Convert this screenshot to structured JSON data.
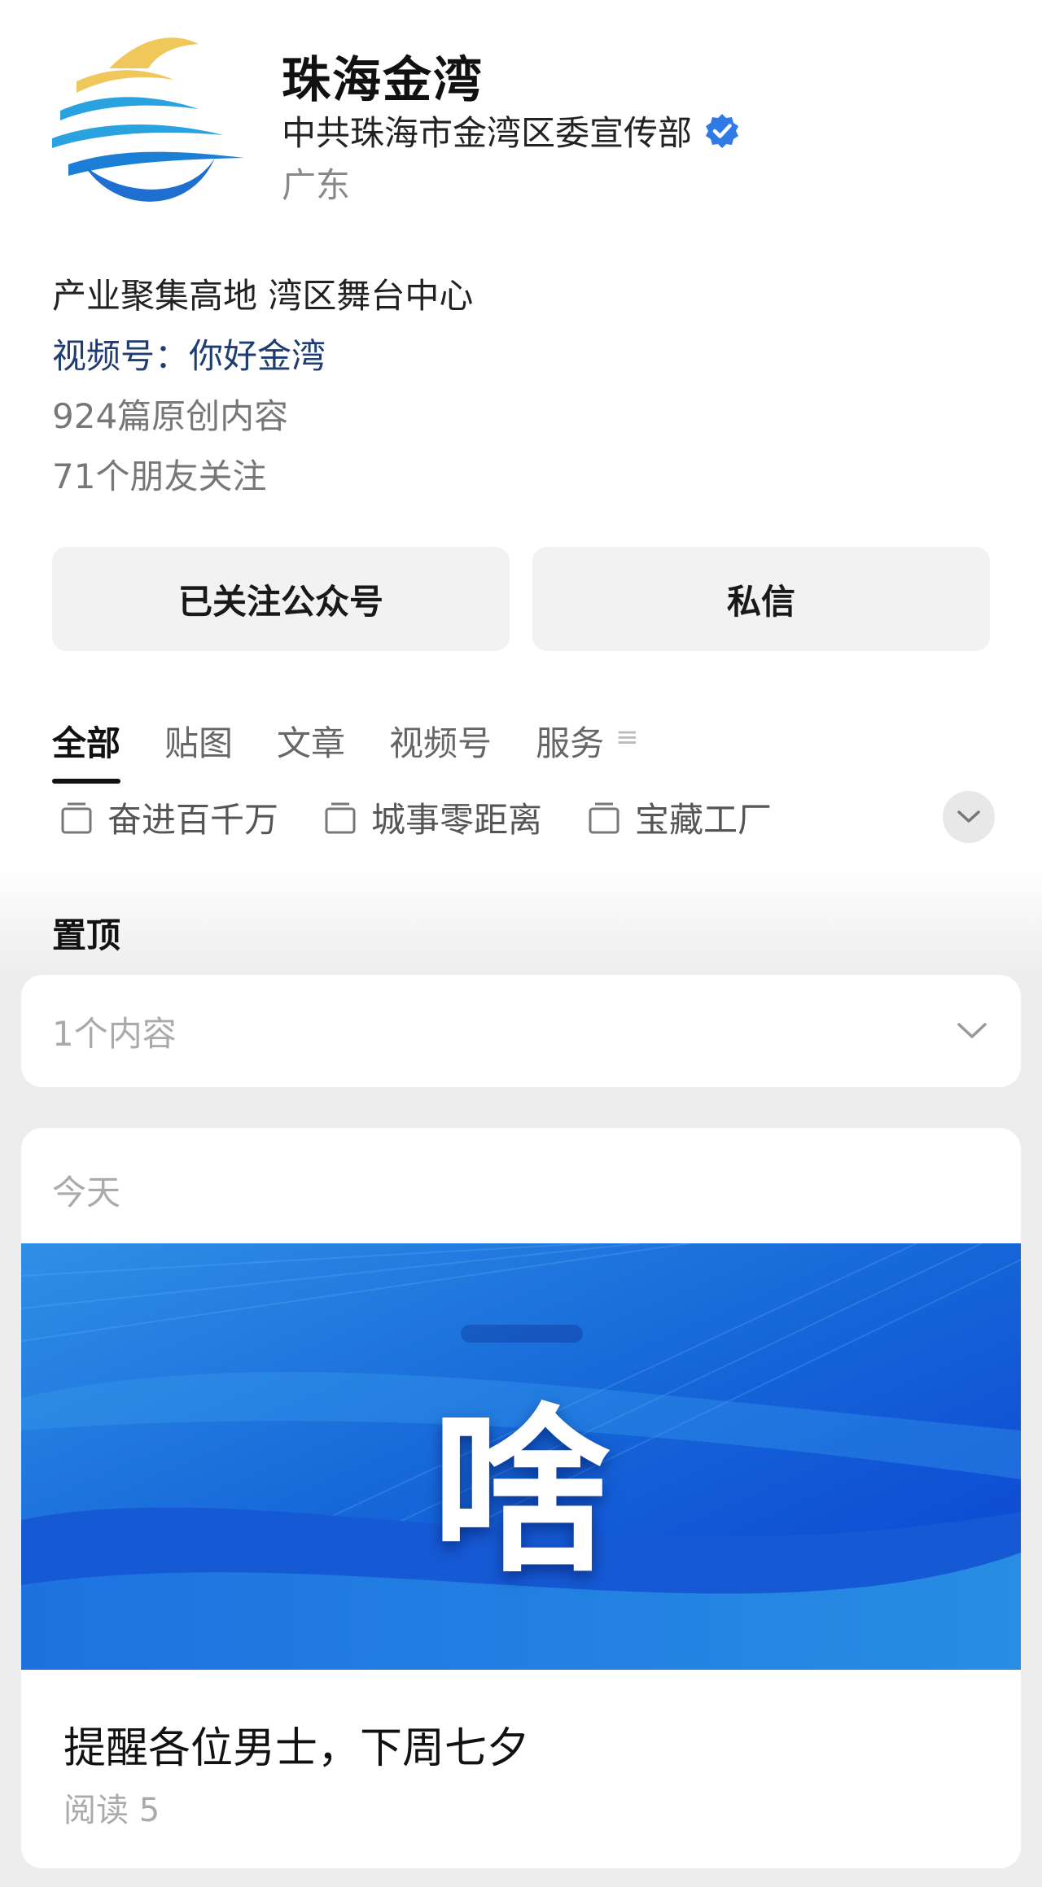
{
  "profile": {
    "name": "珠海金湾",
    "organization": "中共珠海市金湾区委宣传部",
    "region": "广东",
    "bio": "产业聚集高地 湾区舞台中心",
    "channel": "视频号：你好金湾",
    "original_count": "924篇原创内容",
    "friends_following": "71个朋友关注"
  },
  "actions": {
    "follow_label": "已关注公众号",
    "message_label": "私信"
  },
  "tabs": [
    {
      "label": "全部",
      "active": true
    },
    {
      "label": "贴图",
      "active": false
    },
    {
      "label": "文章",
      "active": false
    },
    {
      "label": "视频号",
      "active": false
    },
    {
      "label": "服务",
      "active": false
    }
  ],
  "albums": [
    {
      "label": "奋进百千万",
      "icon": "album-icon"
    },
    {
      "label": "城事零距离",
      "icon": "album-icon"
    },
    {
      "label": "宝藏工厂",
      "icon": "album-icon"
    }
  ],
  "pinned": {
    "title": "置顶",
    "summary": "1个内容"
  },
  "feed": {
    "date": "今天",
    "cover_text": "啥",
    "article_title": "提醒各位男士，下周七夕",
    "reads": "阅读 5"
  },
  "colors": {
    "channel_link": "#1f3d73",
    "verified_badge": "#2f7be6",
    "cover_blue": "#1565d8",
    "logo_gold": "#f0c75a",
    "logo_blue": "#2aa2e0"
  }
}
